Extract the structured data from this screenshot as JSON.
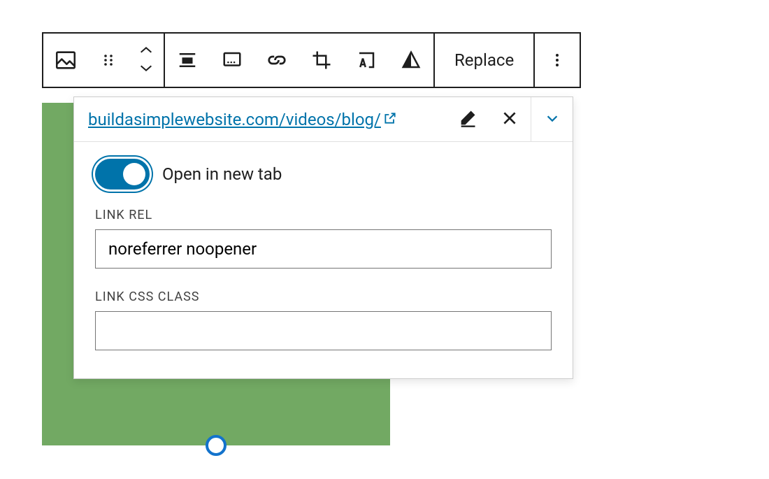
{
  "toolbar": {
    "block_type_icon": "image-icon",
    "drag_icon": "drag-handle-icon",
    "move_up_icon": "chevron-up-icon",
    "move_down_icon": "chevron-down-icon",
    "align_icon": "align-center-icon",
    "caption_icon": "caption-icon",
    "link_icon": "link-icon",
    "crop_icon": "crop-icon",
    "text_overlay_icon": "text-overlay-icon",
    "duotone_icon": "duotone-icon",
    "replace_label": "Replace",
    "more_icon": "more-vertical-icon"
  },
  "image_block": {
    "color": "#72a963"
  },
  "link_popover": {
    "url": "buildasimplewebsite.com/videos/blog/",
    "external_icon": "external-link-icon",
    "edit_icon": "pencil-icon",
    "remove_icon": "close-icon",
    "expand_icon": "chevron-down-icon",
    "open_new_tab": {
      "enabled": true,
      "label": "Open in new tab"
    },
    "link_rel": {
      "label": "LINK REL",
      "value": "noreferrer noopener"
    },
    "link_css_class": {
      "label": "LINK CSS CLASS",
      "value": ""
    }
  },
  "colors": {
    "accent": "#0073aa",
    "border": "#1e1e1e"
  }
}
